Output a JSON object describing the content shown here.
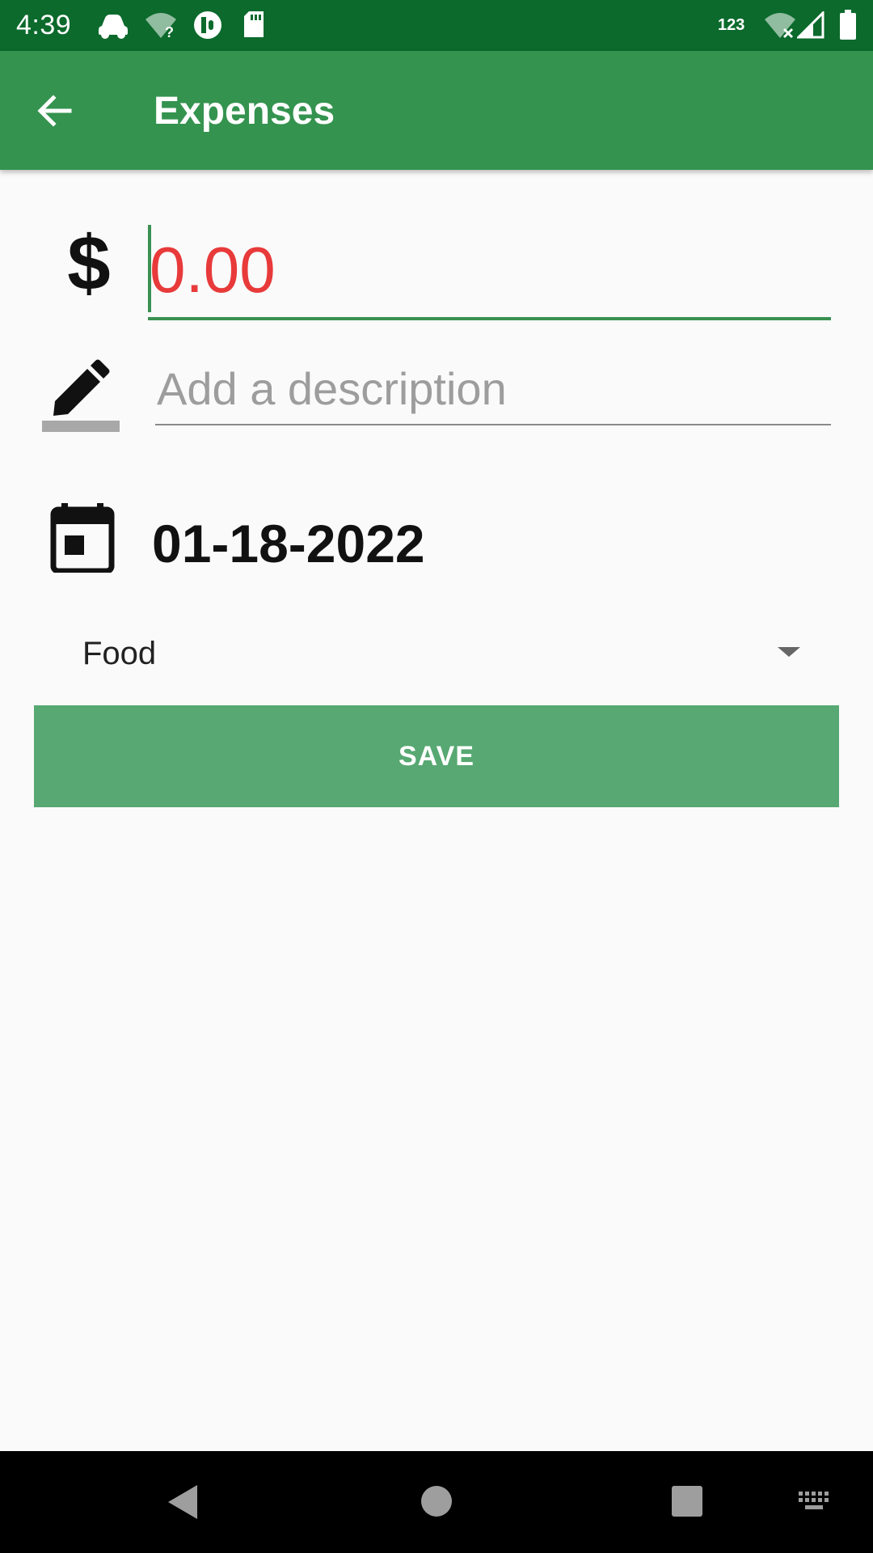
{
  "status_bar": {
    "time": "4:39",
    "network_label": "123",
    "icons": [
      "car-icon",
      "wifi-unknown-icon",
      "app-notification-icon",
      "sd-card-icon",
      "wifi-off-icon",
      "cell-signal-icon",
      "battery-icon"
    ],
    "background": "#0b6a2c"
  },
  "app_bar": {
    "title": "Expenses",
    "back_icon": "arrow-back-icon",
    "background": "#34934f"
  },
  "form": {
    "amount": {
      "icon": "dollar-icon",
      "symbol": "$",
      "value": "0.00",
      "value_color": "#e83a3a",
      "accent": "#3a9152"
    },
    "description": {
      "icon": "pencil-icon",
      "placeholder": "Add a description",
      "value": ""
    },
    "date": {
      "icon": "calendar-icon",
      "value": "01-18-2022"
    },
    "category": {
      "selected": "Food",
      "icon": "dropdown-arrow-icon"
    },
    "save_button": {
      "label": "SAVE",
      "background": "#57a872"
    }
  },
  "nav_bar": {
    "buttons": [
      "back-triangle-icon",
      "home-circle-icon",
      "recents-square-icon",
      "keyboard-icon"
    ]
  }
}
